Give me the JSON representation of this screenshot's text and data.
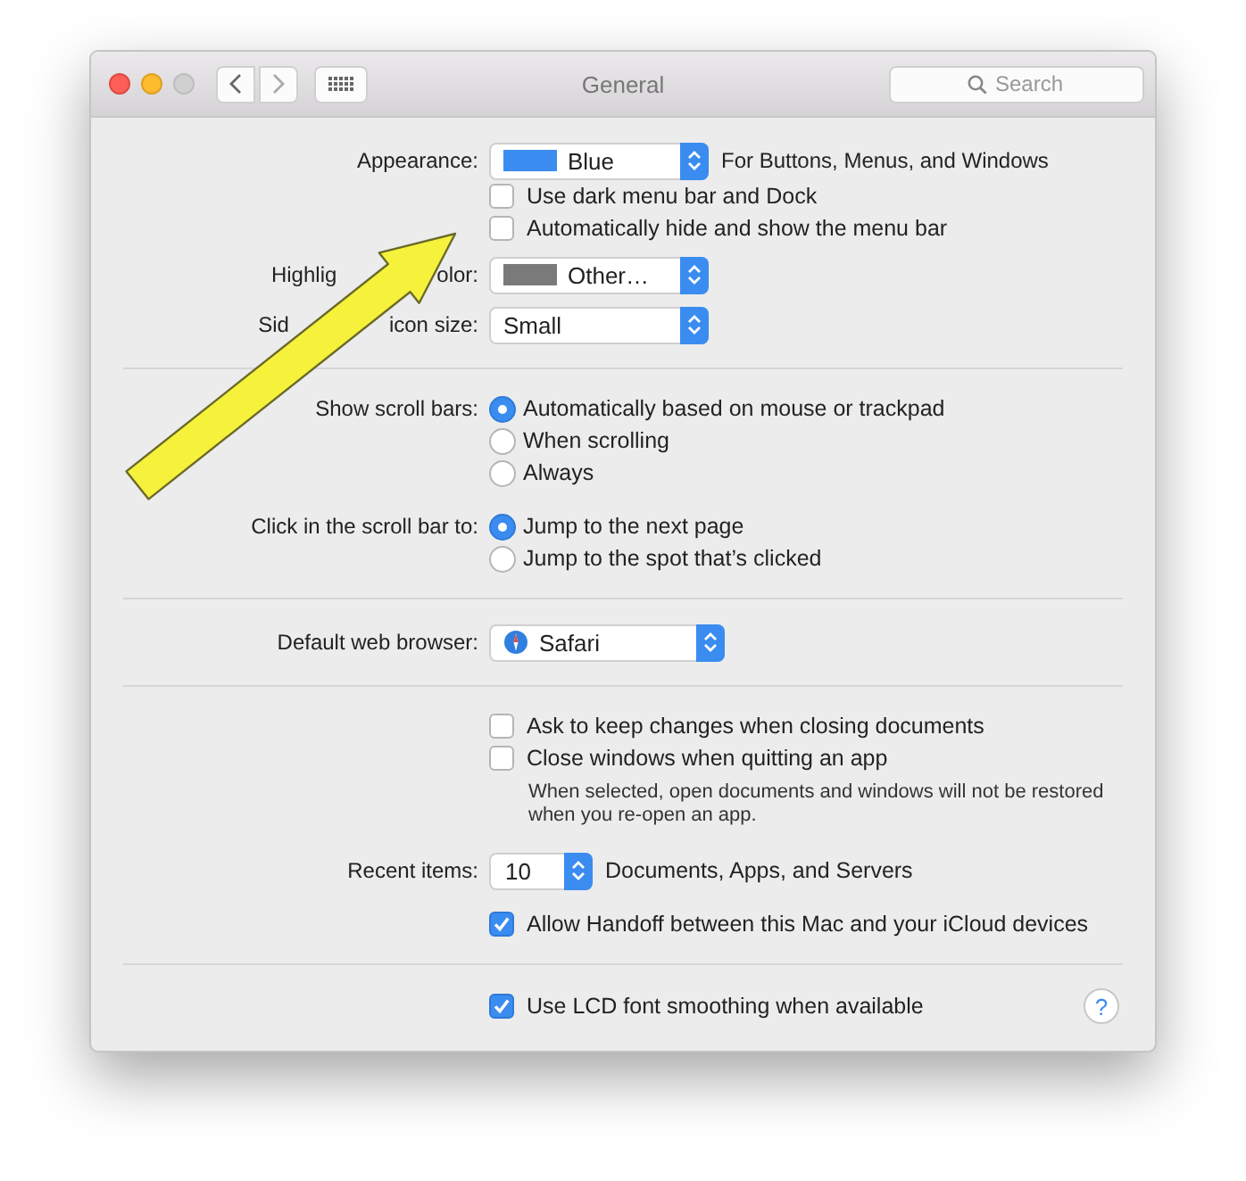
{
  "window": {
    "title": "General",
    "search": {
      "placeholder": "Search"
    },
    "help_button": "?"
  },
  "sections": [
    {
      "rows": [
        {
          "kind": "popup",
          "label_parts": [
            "Appearance:"
          ],
          "value": "Blue",
          "color": "#3a8cf0",
          "suffix": "For Buttons, Menus, and Windows"
        },
        {
          "kind": "checkbox",
          "label": "Use dark menu bar and Dock",
          "checked": false
        },
        {
          "kind": "checkbox",
          "label": "Automatically hide and show the menu bar",
          "checked": false
        },
        {
          "kind": "popup",
          "label_parts": [
            "Highlig",
            "olor:"
          ],
          "value": "Other…",
          "color": "#7a7a7a"
        },
        {
          "kind": "popup",
          "label_parts": [
            "Sid",
            "icon size:"
          ],
          "value": "Small"
        }
      ]
    },
    {
      "rows": [
        {
          "kind": "radio-group",
          "label_parts": [
            "Show scroll bars:"
          ],
          "options": [
            {
              "label": "Automatically based on mouse or trackpad",
              "selected": true
            },
            {
              "label": "When scrolling",
              "selected": false
            },
            {
              "label": "Always",
              "selected": false
            }
          ]
        },
        {
          "kind": "radio-group",
          "label_parts": [
            "Click in the scroll bar to:"
          ],
          "options": [
            {
              "label": "Jump to the next page",
              "selected": true
            },
            {
              "label": "Jump to the spot that’s clicked",
              "selected": false
            }
          ]
        }
      ]
    },
    {
      "rows": [
        {
          "kind": "app-popup",
          "label_parts": [
            "Default web browser:"
          ],
          "value": "Safari"
        }
      ]
    },
    {
      "rows": [
        {
          "kind": "checkbox",
          "label": "Ask to keep changes when closing documents",
          "checked": false
        },
        {
          "kind": "checkbox",
          "label": "Close windows when quitting an app",
          "checked": false
        },
        {
          "kind": "note",
          "text": "When selected, open documents and windows will not be restored when you re-open an app."
        },
        {
          "kind": "stepper",
          "label_parts": [
            "Recent items:"
          ],
          "value": "10",
          "suffix": "Documents, Apps, and Servers"
        },
        {
          "kind": "checkbox",
          "label": "Allow Handoff between this Mac and your iCloud devices",
          "checked": true
        }
      ]
    },
    {
      "rows": [
        {
          "kind": "checkbox",
          "label": "Use LCD font smoothing when available",
          "checked": true,
          "help": true
        }
      ]
    }
  ]
}
